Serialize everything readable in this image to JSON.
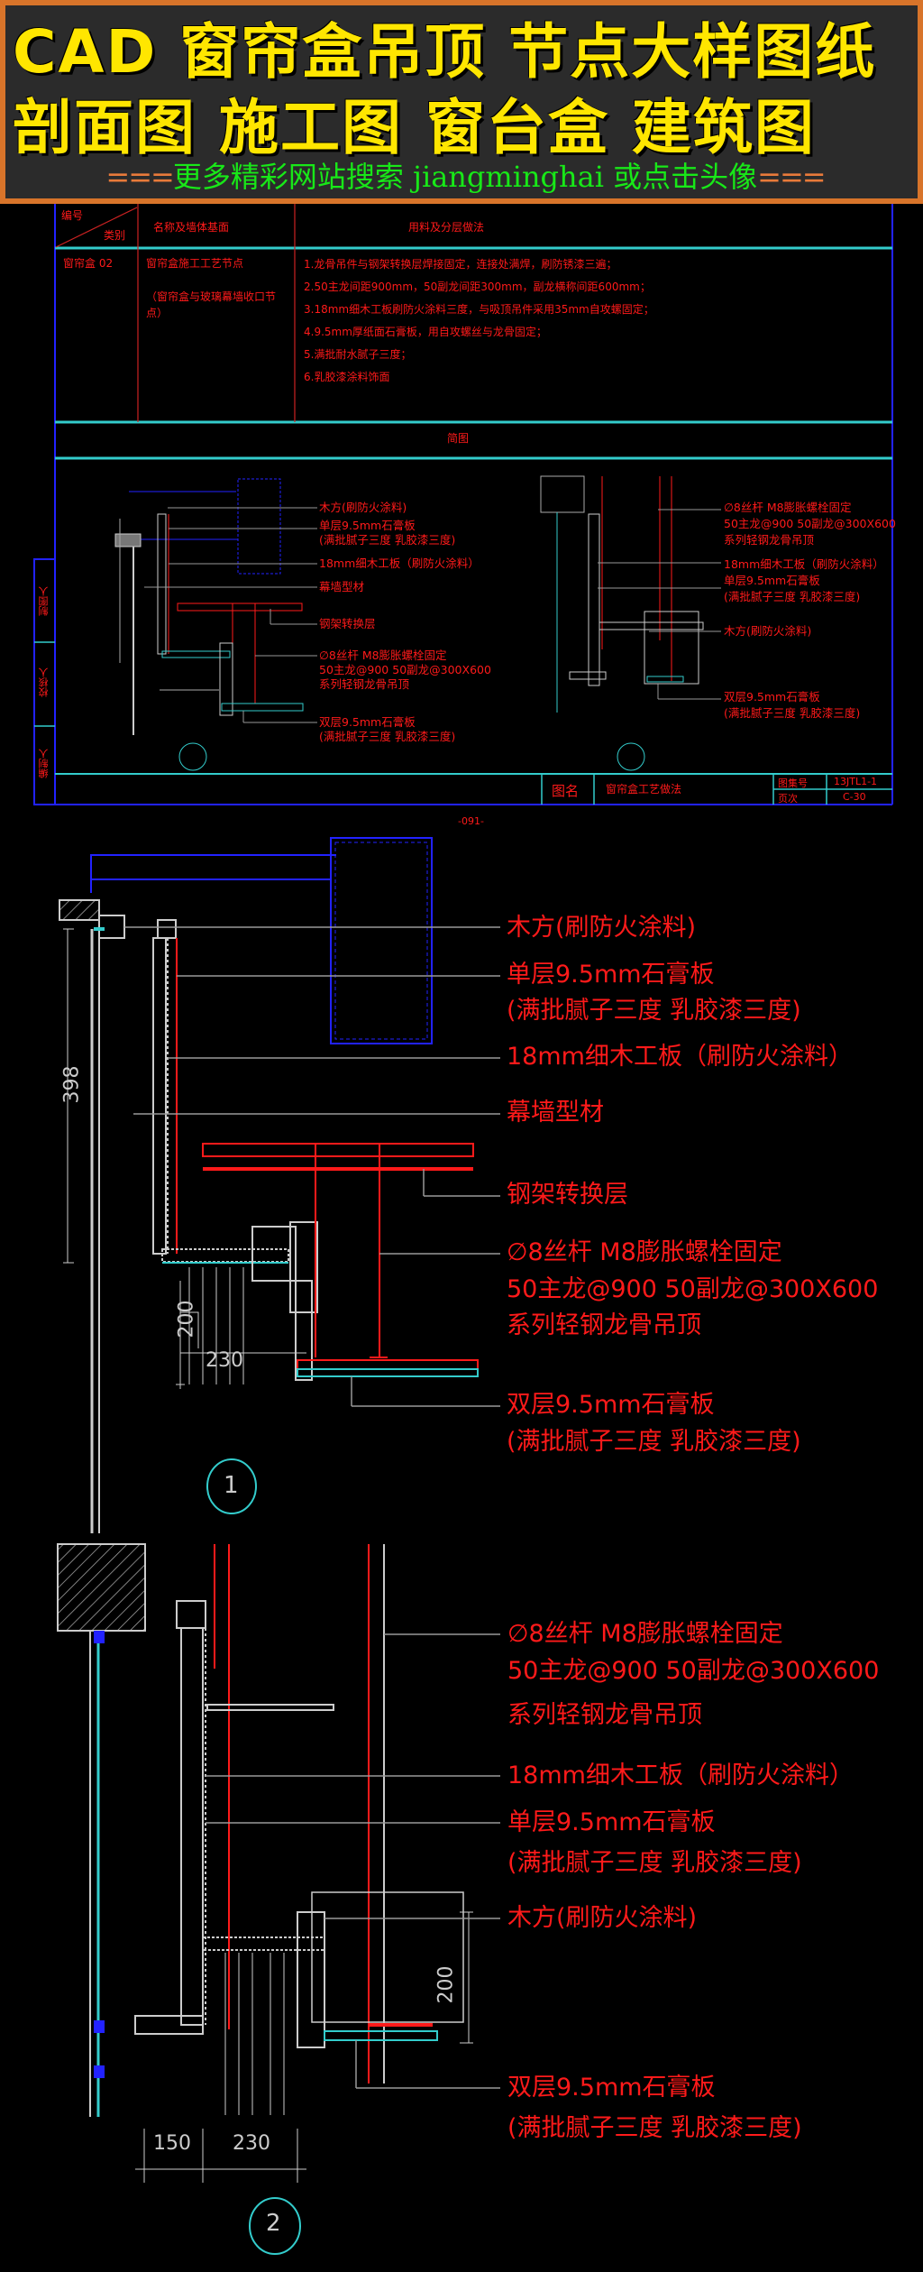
{
  "banner": {
    "line1": "CAD  窗帘盒吊顶  节点大样图纸",
    "line2": "剖面图  施工图  窗台盒  建筑图",
    "line3_dash_left": "===",
    "line3_cn": "更多精彩网站搜索 ",
    "line3_site": "jiangminghai",
    "line3_cn2": " 或点击头像",
    "line3_dash_right": "==="
  },
  "table": {
    "header_number": "编号",
    "header_category": "类别",
    "header_name": "名称及墙体基面",
    "header_method": "用料及分层做法",
    "row_id": "窗帘盒 02",
    "row_name": "窗帘盒施工工艺节点",
    "row_name_note": "（窗帘盒与玻璃幕墙收口节点）",
    "steps": [
      "1.龙骨吊件与钢架转换层焊接固定，连接处满焊，刷防锈漆三遍；",
      "2.50主龙间距900mm，50副龙间距300mm，副龙横称间距600mm；",
      "3.18mm细木工板刷防火涂料三度，与吸顶吊件采用35mm自攻螺固定；",
      "4.9.5mm厚纸面石膏板，用自攻螺丝与龙骨固定；",
      "5.满批耐水腻子三度；",
      "6.乳胶漆涂料饰面"
    ],
    "sketch_title": "简图",
    "side_labels": [
      "制图人",
      "校核人",
      "编制人"
    ],
    "title_label": "图名",
    "title_value": "窗帘盒工艺做法",
    "atlas_label": "图集号",
    "atlas_value": "13JTL1-1",
    "page_label": "页次",
    "page_value": "C-30",
    "page_number": "-091-"
  },
  "detail1": {
    "number": "1",
    "dims": [
      "398",
      "200",
      "230"
    ],
    "labels": [
      "木方(刷防火涂料)",
      "单层9.5mm石膏板",
      "(满批腻子三度 乳胶漆三度)",
      "18mm细木工板（刷防火涂料）",
      "幕墙型材",
      "钢架转换层",
      "∅8丝杆 M8膨胀螺栓固定",
      "50主龙@900  50副龙@300X600",
      "系列轻钢龙骨吊顶",
      "双层9.5mm石膏板",
      "(满批腻子三度 乳胶漆三度)"
    ]
  },
  "detail2": {
    "number": "2",
    "dims": [
      "200",
      "150",
      "230"
    ],
    "labels": [
      "∅8丝杆 M8膨胀螺栓固定",
      "50主龙@900  50副龙@300X600",
      "系列轻钢龙骨吊顶",
      "18mm细木工板（刷防火涂料）",
      "单层9.5mm石膏板",
      "(满批腻子三度 乳胶漆三度)",
      "木方(刷防火涂料)",
      "双层9.5mm石膏板",
      "(满批腻子三度 乳胶漆三度)"
    ]
  },
  "colors": {
    "banner_bg": "#2b2b2b",
    "banner_border": "#d8742a",
    "banner_text": "#ffe600",
    "banner_sub": "#18e818",
    "cad_red": "#ff1a1a",
    "cad_cyan": "#33cccc",
    "cad_blue": "#2222ff"
  }
}
